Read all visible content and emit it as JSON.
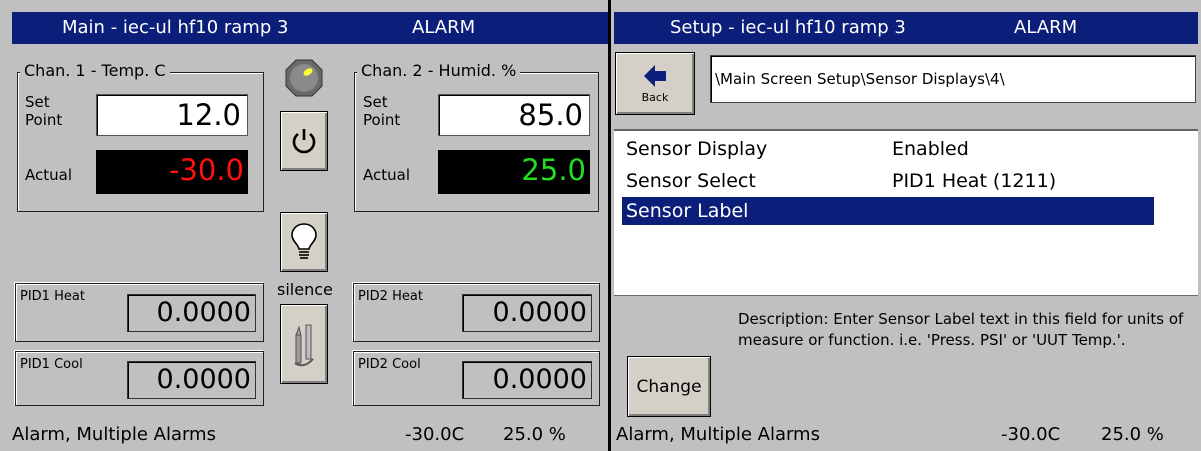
{
  "main": {
    "title": "Main - iec-ul hf10 ramp 3",
    "alarm": "ALARM",
    "chan1": {
      "legend": "Chan. 1 - Temp. C",
      "set_label_1": "Set",
      "set_label_2": "Point",
      "setpoint": "12.0",
      "actual_label": "Actual",
      "actual": "-30.0",
      "actual_color": "#ff1010"
    },
    "chan2": {
      "legend": "Chan. 2 - Humid. %",
      "set_label_1": "Set",
      "set_label_2": "Point",
      "setpoint": "85.0",
      "actual_label": "Actual",
      "actual": "25.0",
      "actual_color": "#20e020"
    },
    "pid1_heat": {
      "label": "PID1 Heat",
      "value": "0.0000"
    },
    "pid1_cool": {
      "label": "PID1 Cool",
      "value": "0.0000"
    },
    "pid2_heat": {
      "label": "PID2 Heat",
      "value": "0.0000"
    },
    "pid2_cool": {
      "label": "PID2 Cool",
      "value": "0.0000"
    },
    "silence_label": "silence",
    "icons": {
      "indicator": "status-light-icon",
      "power": "power-icon",
      "bulb": "lightbulb-icon",
      "tool": "tool-icon"
    },
    "status": {
      "message": "Alarm, Multiple Alarms",
      "temp": "-30.0C",
      "humid": "25.0 %"
    }
  },
  "setup": {
    "title": "Setup - iec-ul hf10 ramp 3",
    "alarm": "ALARM",
    "back_label": "Back",
    "path": "\\Main Screen Setup\\Sensor Displays\\4\\",
    "rows": [
      {
        "key": "Sensor Display",
        "value": "Enabled"
      },
      {
        "key": "Sensor Select",
        "value": "PID1 Heat (1211)"
      },
      {
        "key": "Sensor Label",
        "value": ""
      }
    ],
    "selected_row": 2,
    "description": "Description:  Enter Sensor Label text in this field for units of measure or function. i.e. 'Press. PSI' or 'UUT Temp.'.",
    "change_label": "Change",
    "status": {
      "message": "Alarm, Multiple Alarms",
      "temp": "-30.0C",
      "humid": "25.0 %"
    }
  },
  "colors": {
    "titlebar": "#0b1e7a",
    "panel": "#c0c0c0",
    "selection": "#0b1e7a"
  }
}
